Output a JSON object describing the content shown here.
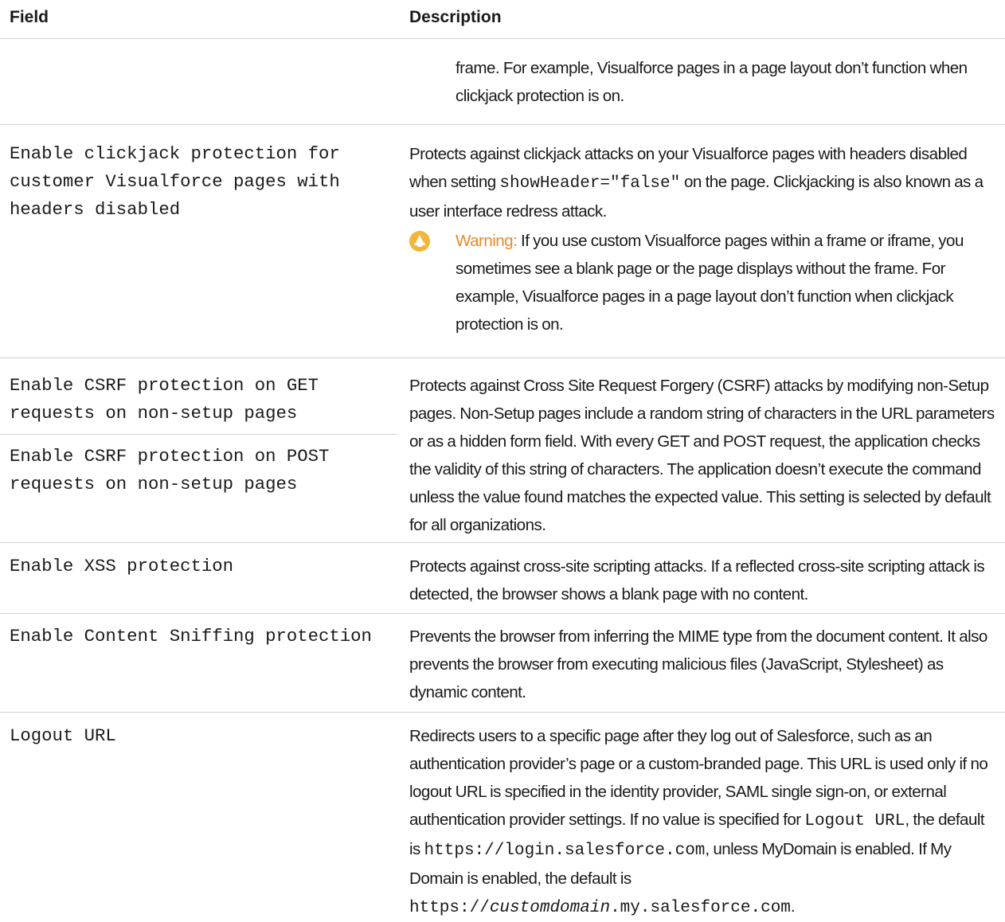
{
  "table": {
    "headers": {
      "field": "Field",
      "description": "Description"
    },
    "continued_warning": {
      "text": "frame. For example, Visualforce pages in a page layout don’t function when clickjack protection is on."
    },
    "rows": [
      {
        "field": "Enable clickjack protection for customer Visualforce pages with headers disabled",
        "description_before": "Protects against clickjack attacks on your Visualforce pages with headers disabled when setting ",
        "description_code": "showHeader=\"false\"",
        "description_after": " on the page. Clickjacking is also known as a user interface redress attack.",
        "warning": {
          "icon": "warning-hat-icon",
          "label": "Warning:",
          "text": " If you use custom Visualforce pages within a frame or iframe, you sometimes see a blank page or the page displays without the frame. For example, Visualforce pages in a page layout don’t function when clickjack protection is on."
        }
      },
      {
        "fields": [
          "Enable CSRF protection on GET requests on non-setup pages",
          "Enable CSRF protection on POST requests on non-setup pages"
        ],
        "description": "Protects against Cross Site Request Forgery (CSRF) attacks by modifying non-Setup pages. Non-Setup pages include a random string of characters in the URL parameters or as a hidden form field. With every GET and POST request, the application checks the validity of this string of characters. The application doesn’t execute the command unless the value found matches the expected value. This setting is selected by default for all organizations."
      },
      {
        "field": "Enable XSS protection",
        "description": "Protects against cross-site scripting attacks. If a reflected cross-site scripting attack is detected, the browser shows a blank page with no content."
      },
      {
        "field": "Enable Content Sniffing protection",
        "description": "Prevents the browser from inferring the MIME type from the document content. It also prevents the browser from executing malicious files (JavaScript, Stylesheet) as dynamic content."
      },
      {
        "field": "Logout URL",
        "description_1": "Redirects users to a specific page after they log out of Salesforce, such as an authentication provider’s page or a custom-branded page. This URL is used only if no logout URL is specified in the identity provider, SAML single sign-on, or external authentication provider settings. If no value is specified for ",
        "code_1": "Logout URL",
        "description_2": ", the default is ",
        "code_2": "https://login.salesforce.com",
        "description_3": ", unless MyDomain is enabled. If My Domain is enabled, the default is ",
        "code_3a": "https://",
        "code_3b": "customdomain",
        "code_3c": ".my.salesforce.com",
        "description_4": "."
      }
    ]
  },
  "colors": {
    "warning_label": "#e88a2a",
    "warning_icon": "#f4b63a",
    "divider": "#d3d3d3"
  }
}
